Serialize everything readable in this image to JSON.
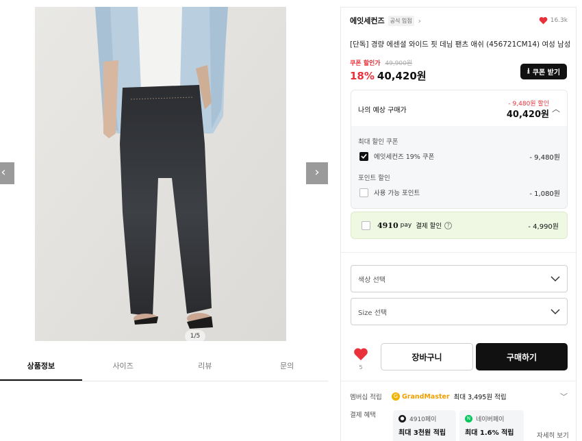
{
  "gallery": {
    "counter": "1/5",
    "prev_icon": "chevron-left-icon",
    "next_icon": "chevron-right-icon"
  },
  "tabs": [
    {
      "label": "상품정보",
      "active": true
    },
    {
      "label": "사이즈",
      "active": false
    },
    {
      "label": "리뷰",
      "active": false
    },
    {
      "label": "문의",
      "active": false
    }
  ],
  "brand": {
    "name": "에잇세컨즈",
    "badge": "공식 입점",
    "likes": "16.3k"
  },
  "product": {
    "title": "[단독] 경량 에센셜 와이드 핏 데님 팬츠 애쉬 (456721CM14) 여성 남성",
    "coupon_label": "쿠폰 할인가",
    "original_price": "49,900원",
    "discount_rate": "18%",
    "sale_price": "40,420원",
    "coupon_button": "쿠폰 받기"
  },
  "estimate": {
    "label": "나의 예상 구매가",
    "discount_text": "- 9,480원 할인",
    "price": "40,420원",
    "max_coupon_title": "최대 할인 쿠폰",
    "coupon_item": {
      "label": "에잇세컨즈 19% 쿠폰",
      "amount": "- 9,480원",
      "checked": true
    },
    "point_title": "포인트 할인",
    "point_item": {
      "label": "사용 가능 포인트",
      "amount": "- 1,080원",
      "checked": false
    }
  },
  "pay": {
    "brand": "4910",
    "brand_sub": "pay",
    "label": "결제 할인",
    "amount": "- 4,990원",
    "checked": false
  },
  "options": {
    "color_placeholder": "색상 선택",
    "size_placeholder": "Size 선택"
  },
  "actions": {
    "like_count": "5",
    "cart": "장바구니",
    "buy": "구매하기"
  },
  "membership": {
    "label": "멤버십 적립",
    "grade": "GrandMaster",
    "max_text": "최대 3,495원 적립"
  },
  "benefits": {
    "label": "결제 혜택",
    "cards": [
      {
        "name": "4910페이",
        "text": "최대 3천원 적립",
        "color": "#1a1a1a"
      },
      {
        "name": "네이버페이",
        "text": "최대 1.6% 적립",
        "color": "#03c75a"
      }
    ],
    "more": "자세히 보기"
  },
  "colors": {
    "accent_red": "#e8313a",
    "dark": "#111111",
    "pay_green_bg": "#eef8e3"
  }
}
